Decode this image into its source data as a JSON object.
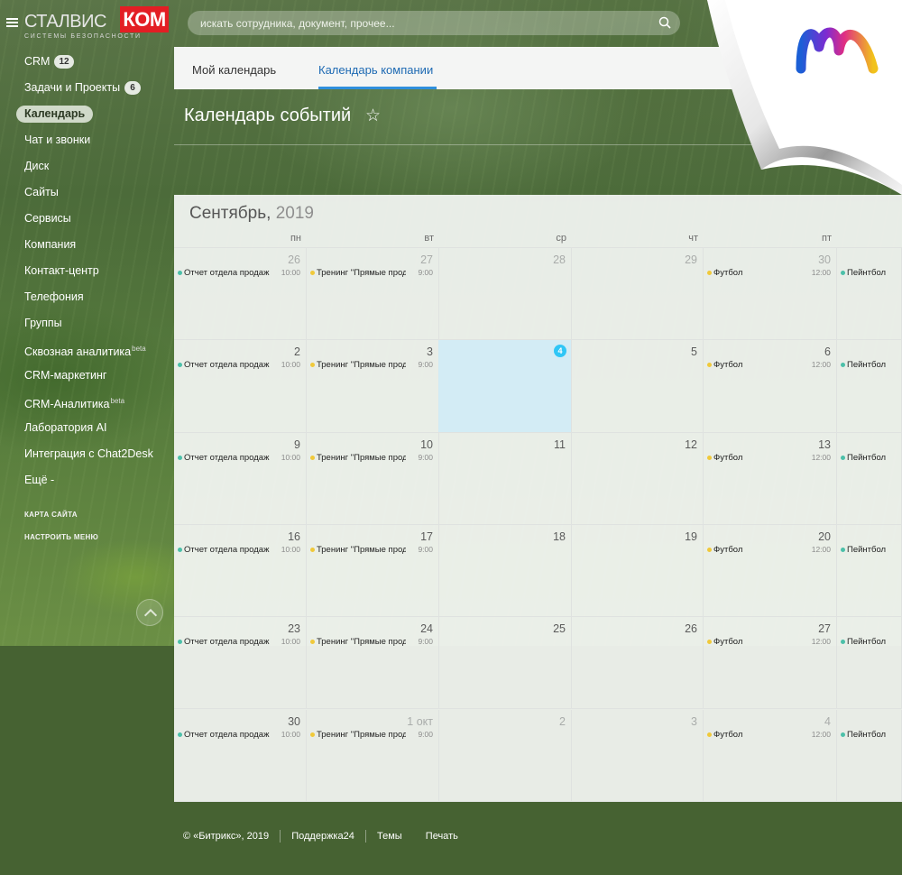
{
  "colors": {
    "brand_red": "#e31e24",
    "accent_blue": "#2f8fdc",
    "today_blue": "#2fc6f6",
    "event_teal": "#4cc0a9",
    "event_yellow": "#f0c93a",
    "footer_bg": "#466232"
  },
  "logo": {
    "left_text": "СТАЛВИС",
    "box_text": "КОМ",
    "subtitle": "СИСТЕМЫ   БЕЗОПАСНОСТИ"
  },
  "search": {
    "placeholder": "искать сотрудника, документ, прочее...",
    "icon": "search-icon"
  },
  "menu": {
    "items": [
      {
        "label": "CRM",
        "badge": "12"
      },
      {
        "label": "Задачи и Проекты",
        "badge": "6"
      },
      {
        "label": "Календарь",
        "active": true
      },
      {
        "label": "Чат и звонки"
      },
      {
        "label": "Диск"
      },
      {
        "label": "Сайты"
      },
      {
        "label": "Сервисы"
      },
      {
        "label": "Компания"
      },
      {
        "label": "Контакт-центр"
      },
      {
        "label": "Телефония"
      },
      {
        "label": "Группы"
      },
      {
        "label": "Сквозная аналитика",
        "sup": "beta"
      },
      {
        "label": "CRM-маркетинг"
      },
      {
        "label": "CRM-Аналитика",
        "sup": "beta"
      },
      {
        "label": "Лаборатория AI"
      },
      {
        "label": "Интеграция с Chat2Desk"
      },
      {
        "label": "Ещё -"
      }
    ],
    "sitemap": "КАРТА САЙТА",
    "configure": "НАСТРОИТЬ МЕНЮ"
  },
  "tabs": [
    {
      "label": "Мой календарь"
    },
    {
      "label": "Календарь компании",
      "active": true
    }
  ],
  "page": {
    "title": "Календарь событий",
    "star": "☆"
  },
  "calendar": {
    "month": "Сентябрь,",
    "year": "2019",
    "weekdays": [
      "пн",
      "вт",
      "ср",
      "чт",
      "пт"
    ],
    "weeks": [
      {
        "days": [
          "26",
          "27",
          "28",
          "29",
          "30"
        ],
        "other_month": [
          true,
          true,
          true,
          true,
          true
        ]
      },
      {
        "days": [
          "2",
          "3",
          "4",
          "5",
          "6"
        ],
        "today_index": 2
      },
      {
        "days": [
          "9",
          "10",
          "11",
          "12",
          "13"
        ]
      },
      {
        "days": [
          "16",
          "17",
          "18",
          "19",
          "20"
        ]
      },
      {
        "days": [
          "23",
          "24",
          "25",
          "26",
          "27"
        ]
      },
      {
        "days": [
          "30",
          "1 окт",
          "2",
          "3",
          "4"
        ],
        "other_month": [
          false,
          true,
          true,
          true,
          true
        ]
      }
    ],
    "events": {
      "mon": {
        "name": "Отчет отдела продаж",
        "time": "10:00"
      },
      "tue": {
        "name": "Тренинг \"Прямые продажи\"",
        "time": "9:00"
      },
      "fri": {
        "name": "Футбол",
        "time": "12:00"
      },
      "sat": {
        "name": "Пейнтбол"
      }
    }
  },
  "footer": {
    "copyright": "© «Битрикс», 2019",
    "support": "Поддержка24",
    "themes": "Темы",
    "print": "Печать"
  }
}
